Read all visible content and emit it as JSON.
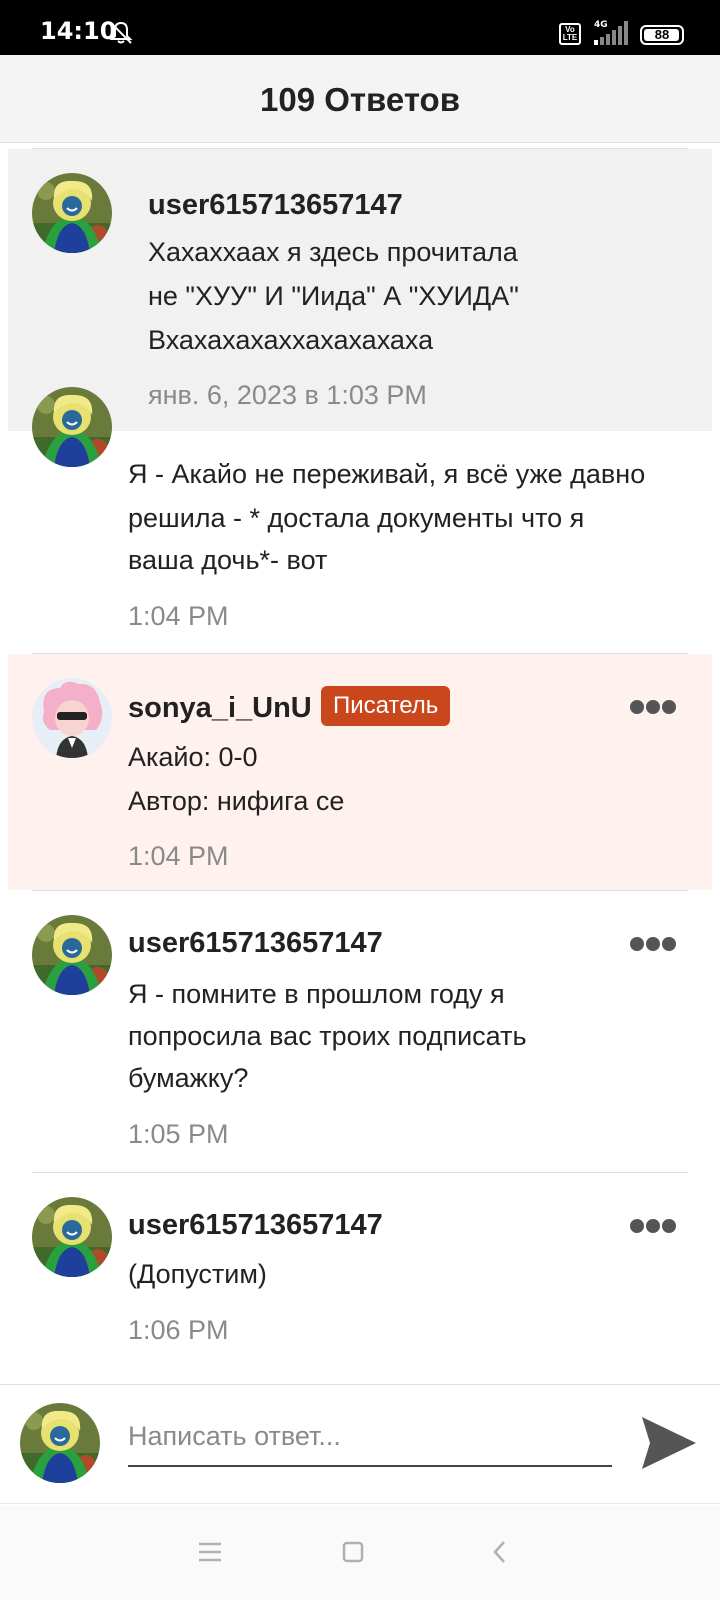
{
  "status_bar": {
    "time": "14:10",
    "notifications_icon": "bell-muted-icon",
    "volte_label": "Vo LTE",
    "network_label": "4G",
    "battery_level": "88"
  },
  "header": {
    "title": "109 Ответов"
  },
  "comments": [
    {
      "username": "user615713657147",
      "lines": [
        "Хахаххаах я здесь прочитала",
        "не \"ХУУ\" И \"Иида\" А \"ХУИДА\"",
        "Вхахахахаххахахахаха"
      ],
      "time": "янв. 6, 2023 в 1:03 PM"
    },
    {
      "username": "",
      "lines": [
        "Я - Акайо не переживай, я всё уже давно",
        "решила  - * достала документы что я",
        "ваша дочь*- вот"
      ],
      "time": "1:04 PM"
    },
    {
      "username": "sonya_i_UnU",
      "badge": "Писатель",
      "lines": [
        "Акайо: 0-0",
        "Автор: нифига се"
      ],
      "time": "1:04 PM"
    },
    {
      "username": "user615713657147",
      "lines": [
        "Я - помните в прошлом году я",
        "попросила вас троих подписать",
        "бумажку?"
      ],
      "time": "1:05 PM"
    },
    {
      "username": "user615713657147",
      "lines": [
        "(Допустим)"
      ],
      "time": "1:06 PM"
    }
  ],
  "reply": {
    "placeholder": "Написать ответ...",
    "send_icon": "send-icon"
  },
  "nav": {
    "icons": [
      "menu-icon",
      "home-icon",
      "back-icon"
    ]
  },
  "colors": {
    "writer_badge": "#c9471b",
    "writer_row_bg": "#fef1ee",
    "highlight_row_bg": "#f1f1f1"
  }
}
